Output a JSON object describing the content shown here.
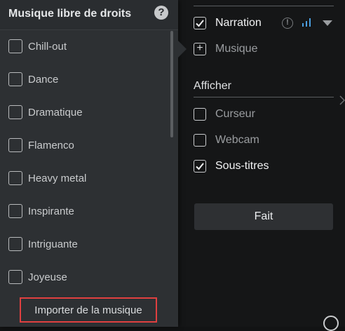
{
  "popup": {
    "title": "Musique libre de droits",
    "help_icon": "?",
    "genres": [
      {
        "label": "Chill-out",
        "checked": false
      },
      {
        "label": "Dance",
        "checked": false
      },
      {
        "label": "Dramatique",
        "checked": false
      },
      {
        "label": "Flamenco",
        "checked": false
      },
      {
        "label": "Heavy metal",
        "checked": false
      },
      {
        "label": "Inspirante",
        "checked": false
      },
      {
        "label": "Intriguante",
        "checked": false
      },
      {
        "label": "Joyeuse",
        "checked": false
      }
    ],
    "import_label": "Importer de la musique"
  },
  "audio": {
    "narration_label": "Narration",
    "narration_checked": true,
    "music_label": "Musique"
  },
  "display": {
    "title": "Afficher",
    "options": [
      {
        "label": "Curseur",
        "checked": false
      },
      {
        "label": "Webcam",
        "checked": false
      },
      {
        "label": "Sous-titres",
        "checked": true
      }
    ]
  },
  "done_label": "Fait",
  "colors": {
    "accent_blue": "#4a9fe0",
    "highlight_red": "#e04040"
  }
}
